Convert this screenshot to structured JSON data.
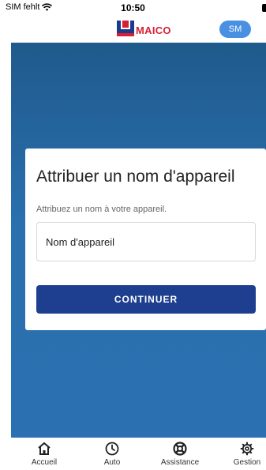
{
  "status_bar": {
    "carrier": "SIM fehlt",
    "time": "10:50"
  },
  "header": {
    "logo_text": "MAICO",
    "avatar_initials": "SM"
  },
  "card": {
    "title": "Attribuer un nom d'appareil",
    "subtitle": "Attribuez un nom à votre appareil.",
    "input_placeholder": "Nom d'appareil",
    "input_value": "",
    "continue_label": "CONTINUER"
  },
  "tabs": [
    {
      "label": "Accueil",
      "icon": "home-icon"
    },
    {
      "label": "Auto",
      "icon": "clock-icon"
    },
    {
      "label": "Assistance",
      "icon": "lifebuoy-icon"
    },
    {
      "label": "Gestion",
      "icon": "gear-icon"
    }
  ],
  "colors": {
    "brand_red": "#d81e34",
    "brand_blue": "#1e3f8f",
    "avatar": "#4a90e2"
  }
}
